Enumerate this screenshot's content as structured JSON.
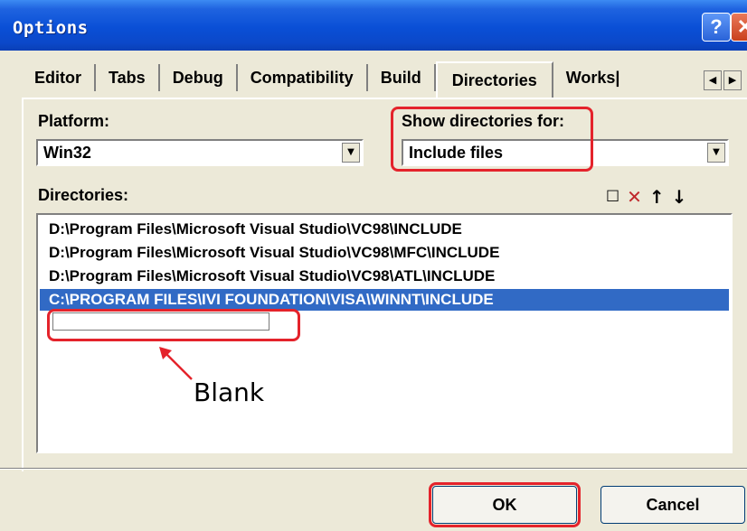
{
  "window": {
    "title": "Options",
    "help_label": "?",
    "close_label": "✕"
  },
  "tabs": [
    {
      "label": "Editor"
    },
    {
      "label": "Tabs"
    },
    {
      "label": "Debug"
    },
    {
      "label": "Compatibility"
    },
    {
      "label": "Build"
    },
    {
      "label": "Directories",
      "active": true
    },
    {
      "label": "Works|"
    }
  ],
  "platform": {
    "label": "Platform:",
    "value": "Win32"
  },
  "show_for": {
    "label": "Show directories for:",
    "value": "Include files"
  },
  "directories": {
    "label": "Directories:",
    "items": [
      "D:\\Program Files\\Microsoft Visual Studio\\VC98\\INCLUDE",
      "D:\\Program Files\\Microsoft Visual Studio\\VC98\\MFC\\INCLUDE",
      "D:\\Program Files\\Microsoft Visual Studio\\VC98\\ATL\\INCLUDE",
      "C:\\PROGRAM FILES\\IVI FOUNDATION\\VISA\\WINNT\\INCLUDE"
    ],
    "selected_index": 3,
    "new_entry_value": ""
  },
  "annotation": {
    "text": "Blank",
    "color": "#e4232b"
  },
  "buttons": {
    "ok": "OK",
    "cancel": "Cancel"
  }
}
